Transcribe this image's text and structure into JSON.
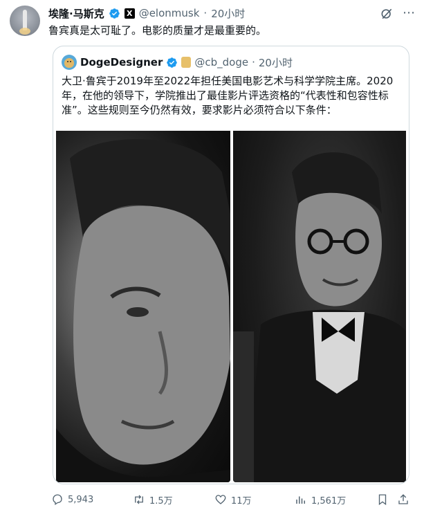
{
  "author": {
    "name": "埃隆·马斯克",
    "handle": "@elonmusk",
    "time": "20小时",
    "separator": "·",
    "x_badge": "X"
  },
  "tweet_text": "鲁宾真是太可耻了。电影的质量才是最重要的。",
  "quoted": {
    "name": "DogeDesigner",
    "handle": "@cb_doge",
    "time": "20小时",
    "separator": "·",
    "text": "大卫·鲁宾于2019年至2022年担任美国电影艺术与科学学院主席。2020年，在他的领导下，学院推出了最佳影片评选资格的“代表性和包容性标准”。这些规则至今仍然有效，要求影片必须符合以下条件："
  },
  "actions": {
    "replies": "5,943",
    "reposts": "1.5万",
    "likes": "11万",
    "views": "1,561万"
  },
  "icons": [
    "grok-icon",
    "more-icon",
    "verified-icon",
    "x-badge-icon",
    "reply-icon",
    "repost-icon",
    "like-icon",
    "views-icon",
    "bookmark-icon",
    "share-icon"
  ],
  "colors": {
    "verified": "#1d9bf0",
    "muted": "#536471",
    "border": "#cfd9de",
    "text": "#0f1419"
  }
}
